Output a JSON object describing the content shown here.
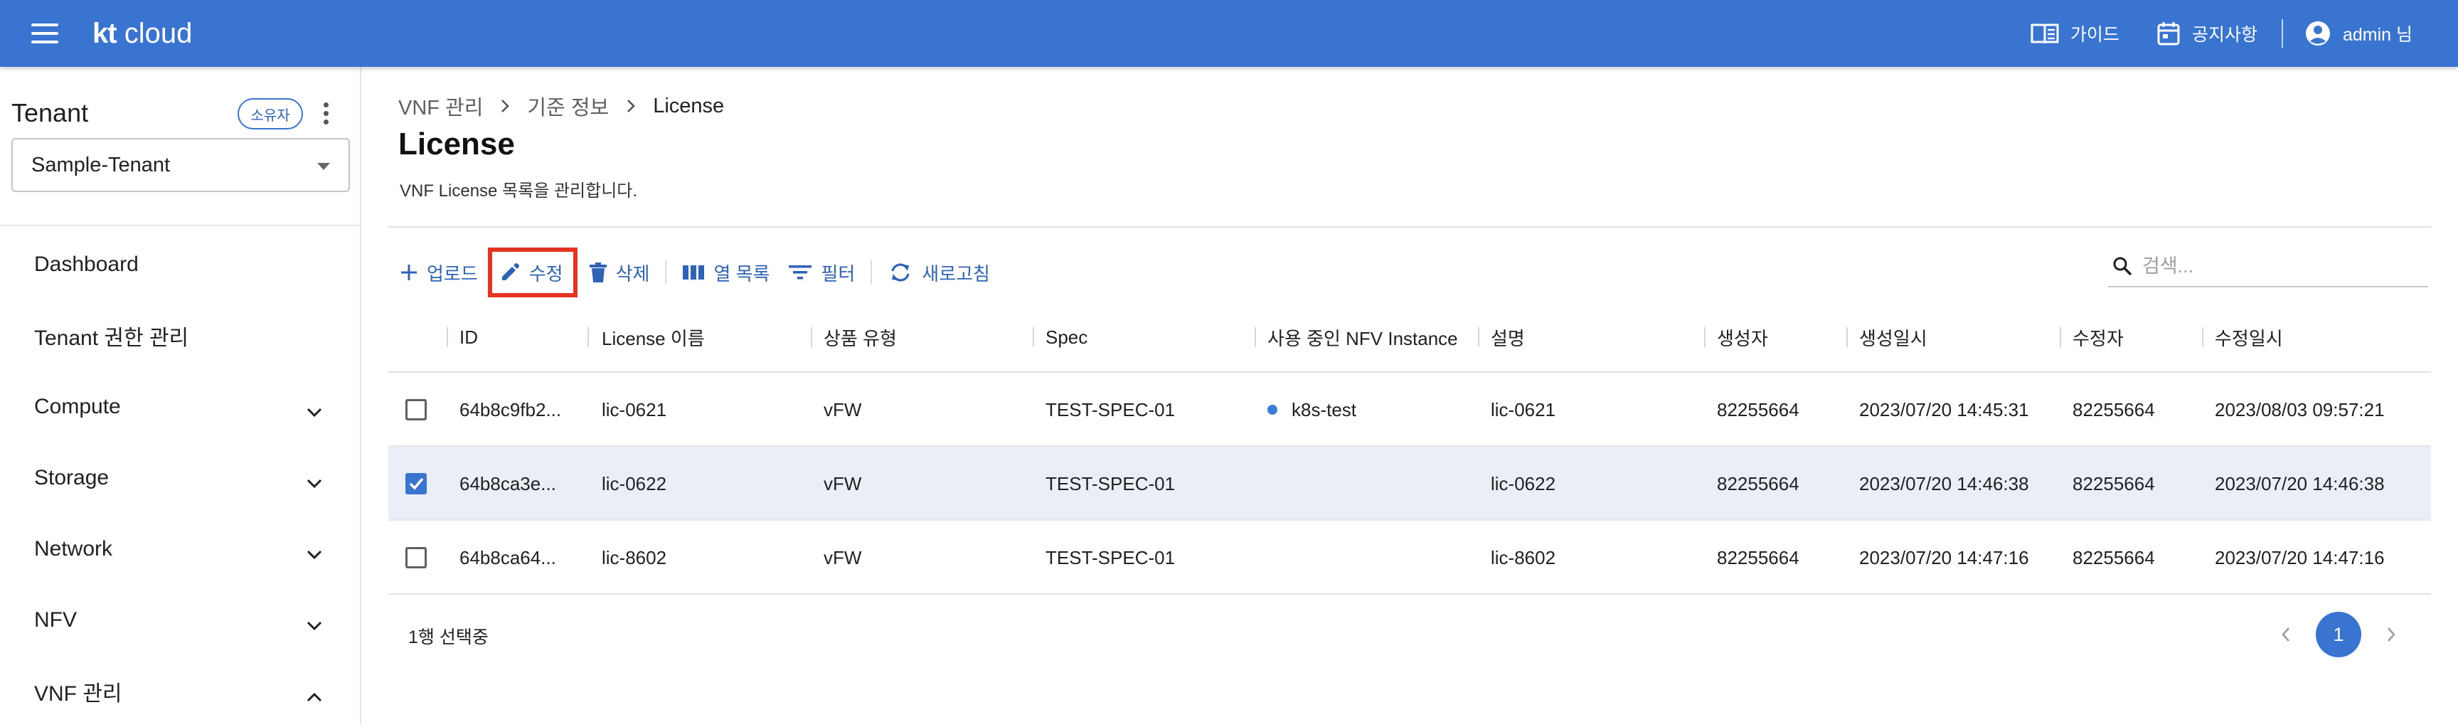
{
  "header": {
    "logo_kt": "kt",
    "logo_word": "cloud",
    "guide_label": "가이드",
    "notice_label": "공지사항",
    "user_label": "admin 님",
    "bg_color": "#3a74d1"
  },
  "sidebar": {
    "tenant_title": "Tenant",
    "owner_badge": "소유자",
    "tenant_selected": "Sample-Tenant",
    "items": [
      {
        "label": "Dashboard",
        "expandable": false
      },
      {
        "label": "Tenant 권한 관리",
        "expandable": false
      },
      {
        "label": "Compute",
        "expandable": true,
        "expanded": false
      },
      {
        "label": "Storage",
        "expandable": true,
        "expanded": false
      },
      {
        "label": "Network",
        "expandable": true,
        "expanded": false
      },
      {
        "label": "NFV",
        "expandable": true,
        "expanded": false
      },
      {
        "label": "VNF 관리",
        "expandable": true,
        "expanded": true
      }
    ]
  },
  "breadcrumb": [
    "VNF 관리",
    "기준 정보",
    "License"
  ],
  "page": {
    "title": "License",
    "description": "VNF License 목록을 관리합니다."
  },
  "toolbar": {
    "upload": "업로드",
    "edit": "수정",
    "delete": "삭제",
    "columns": "열 목록",
    "filter": "필터",
    "refresh": "새로고침",
    "highlight_color": "#e53322"
  },
  "search": {
    "placeholder": "검색..."
  },
  "table": {
    "headers": [
      "ID",
      "License 이름",
      "상품 유형",
      "Spec",
      "사용 중인 NFV Instance",
      "설명",
      "생성자",
      "생성일시",
      "수정자",
      "수정일시"
    ],
    "rows": [
      {
        "checked": false,
        "id": "64b8c9fb2...",
        "name": "lic-0621",
        "type": "vFW",
        "spec": "TEST-SPEC-01",
        "instance": "k8s-test",
        "desc": "lic-0621",
        "creator": "82255664",
        "created": "2023/07/20 14:45:31",
        "modifier": "82255664",
        "modified": "2023/08/03 09:57:21"
      },
      {
        "checked": true,
        "id": "64b8ca3e...",
        "name": "lic-0622",
        "type": "vFW",
        "spec": "TEST-SPEC-01",
        "instance": "",
        "desc": "lic-0622",
        "creator": "82255664",
        "created": "2023/07/20 14:46:38",
        "modifier": "82255664",
        "modified": "2023/07/20 14:46:38"
      },
      {
        "checked": false,
        "id": "64b8ca64...",
        "name": "lic-8602",
        "type": "vFW",
        "spec": "TEST-SPEC-01",
        "instance": "",
        "desc": "lic-8602",
        "creator": "82255664",
        "created": "2023/07/20 14:47:16",
        "modifier": "82255664",
        "modified": "2023/07/20 14:47:16"
      }
    ]
  },
  "footer": {
    "selection": "1행 선택중",
    "current_page": "1"
  }
}
